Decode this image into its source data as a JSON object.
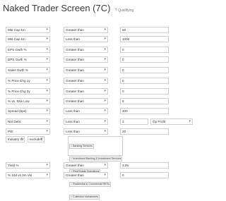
{
  "header": {
    "title": "Naked Trader Screen (7C)",
    "subtitle": "? Qualifying"
  },
  "rows": [
    {
      "field": "Mkt Cap £m",
      "op": "Greater than",
      "value": "50"
    },
    {
      "field": "Mkt Cap £m",
      "op": "Less than",
      "value": "1000"
    },
    {
      "field": "EPS Gwth %",
      "op": "Greater than",
      "value": "0"
    },
    {
      "field": "DPS Gwth %",
      "op": "Greater than",
      "value": "0"
    },
    {
      "field": "Sales Gwth %",
      "op": "Greater than",
      "value": "0"
    },
    {
      "field": "% Price Chg 1y",
      "op": "Greater than",
      "value": "0"
    },
    {
      "field": "% Price Chg 3y",
      "op": "Greater than",
      "value": "0"
    },
    {
      "field": "% vs. 52w Low",
      "op": "Greater than",
      "value": "5"
    },
    {
      "field": "Spread (bps)",
      "op": "Less than",
      "value": "400"
    },
    {
      "field": "Net Debt",
      "op": "Less than",
      "value": "3",
      "extra": "Op Profit"
    },
    {
      "field": "P/E",
      "op": "Less than",
      "value": "20"
    }
  ],
  "industry": {
    "field": "Industry Group",
    "mode": "excludes",
    "tags": [
      "Banking Services",
      "Investment Banking & Investment Services",
      "Real Estate Operations",
      "Residential & Commercial REITs",
      "Collective Investments"
    ]
  },
  "bottom_rows": [
    {
      "field": "Yield %",
      "op": "Greater than",
      "value": "3.25"
    },
    {
      "field": "% 10d vs 3m Vol",
      "op": "Greater than",
      "value": "0"
    }
  ]
}
